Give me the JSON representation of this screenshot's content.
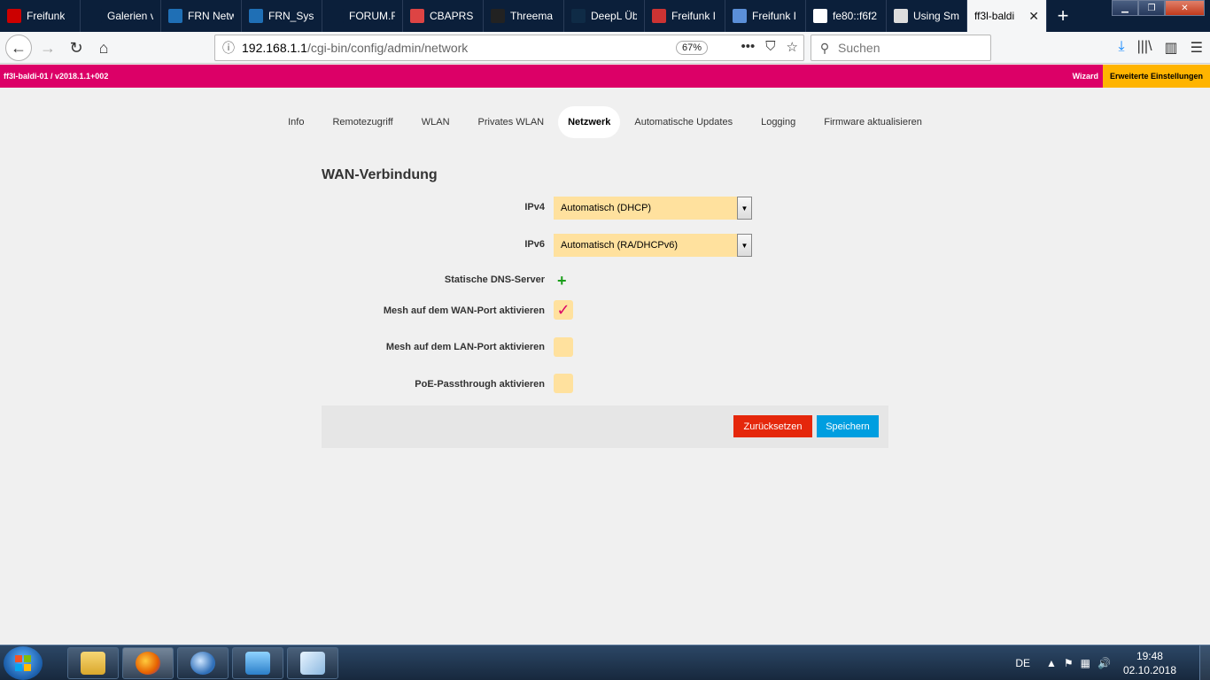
{
  "browser": {
    "tabs": [
      {
        "label": "Freifunk ",
        "icon": "freifunk-icon",
        "color": "#c00"
      },
      {
        "label": "Galerien verw",
        "icon": "blank-icon",
        "color": "#0b1f3a"
      },
      {
        "label": "FRN Netw",
        "icon": "frn-icon",
        "color": "#1f6fb5"
      },
      {
        "label": "FRN_Sysn",
        "icon": "frn-icon",
        "color": "#1f6fb5"
      },
      {
        "label": "FORUM.FREE",
        "icon": "blank-icon",
        "color": "#0b1f3a"
      },
      {
        "label": "CBAPRS",
        "icon": "antenna-icon",
        "color": "#d44"
      },
      {
        "label": "Threema",
        "icon": "threema-icon",
        "color": "#222"
      },
      {
        "label": "DeepL Üb",
        "icon": "deepl-icon",
        "color": "#0f2b46"
      },
      {
        "label": "Freifunk I",
        "icon": "freifunk-icon",
        "color": "#c33"
      },
      {
        "label": "Freifunk I",
        "icon": "map-icon",
        "color": "#5b8fd8"
      },
      {
        "label": "fe80::f6f2",
        "icon": "google-icon",
        "color": "#fff"
      },
      {
        "label": "Using Sm",
        "icon": "wordpress-icon",
        "color": "#ddd"
      }
    ],
    "active_tab": "ff3l-baldi",
    "url_host": "192.168.1.1",
    "url_path": "/cgi-bin/config/admin/network",
    "zoom": "67%",
    "search_placeholder": "Suchen"
  },
  "router": {
    "host_info": "ff3l-baldi-01 / v2018.1.1+002",
    "wizard": "Wizard",
    "advanced": "Erweiterte Einstellungen",
    "brand_color": "#dc0067",
    "accent_color": "#ffb400"
  },
  "menu": [
    {
      "label": "Info"
    },
    {
      "label": "Remotezugriff"
    },
    {
      "label": "WLAN"
    },
    {
      "label": "Privates WLAN"
    },
    {
      "label": "Netzwerk"
    },
    {
      "label": "Automatische Updates"
    },
    {
      "label": "Logging"
    },
    {
      "label": "Firmware aktualisieren"
    }
  ],
  "active_menu": "Netzwerk",
  "form": {
    "title": "WAN-Verbindung",
    "ipv4_label": "IPv4",
    "ipv4_value": "Automatisch (DHCP)",
    "ipv6_label": "IPv6",
    "ipv6_value": "Automatisch (RA/DHCPv6)",
    "dns_label": "Statische DNS-Server",
    "mesh_wan_label": "Mesh auf dem WAN-Port aktivieren",
    "mesh_wan_checked": true,
    "mesh_lan_label": "Mesh auf dem LAN-Port aktivieren",
    "mesh_lan_checked": false,
    "poe_label": "PoE-Passthrough aktivieren",
    "poe_checked": false,
    "reset_label": "Zurücksetzen",
    "save_label": "Speichern"
  },
  "taskbar": {
    "language": "DE",
    "time": "19:48",
    "date": "02.10.2018"
  }
}
